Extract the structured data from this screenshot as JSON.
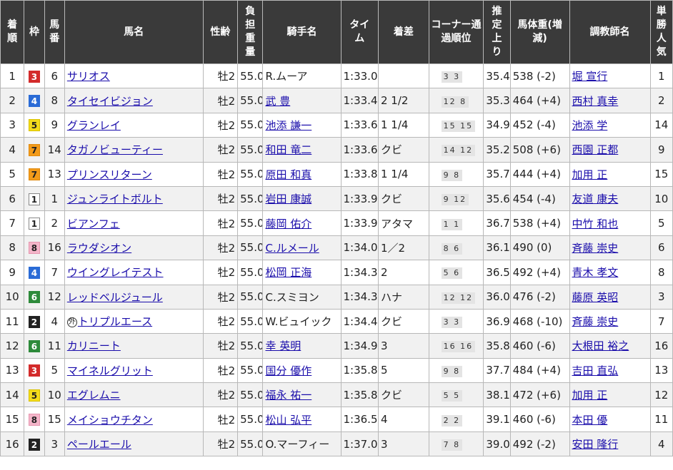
{
  "headers": {
    "rank": "着順",
    "waku": "枠",
    "umaban": "馬番",
    "horse": "馬名",
    "sexage": "性齢",
    "weight": "負担重量",
    "jockey": "騎手名",
    "time": "タイム",
    "margin": "着差",
    "corner": "コーナー通過順位",
    "last3f": "推定上り",
    "body": "馬体重(増減)",
    "trainer": "調教師名",
    "pop": "単勝人気"
  },
  "rows": [
    {
      "rank": "1",
      "waku": "3",
      "umaban": "6",
      "foreign": "",
      "horse": "サリオス",
      "sexage": "牡2",
      "weight": "55.0",
      "jockey": "R.ムーア",
      "jockey_link": false,
      "time": "1:33.0",
      "margin": "",
      "corner": "3 3",
      "last3f": "35.4",
      "body": "538 (-2)",
      "trainer": "堀 宣行",
      "pop": "1"
    },
    {
      "rank": "2",
      "waku": "4",
      "umaban": "8",
      "foreign": "",
      "horse": "タイセイビジョン",
      "sexage": "牡2",
      "weight": "55.0",
      "jockey": "武 豊",
      "jockey_link": true,
      "time": "1:33.4",
      "margin": "2 1/2",
      "corner": "12 8",
      "last3f": "35.3",
      "body": "464 (+4)",
      "trainer": "西村 真幸",
      "pop": "2"
    },
    {
      "rank": "3",
      "waku": "5",
      "umaban": "9",
      "foreign": "",
      "horse": "グランレイ",
      "sexage": "牡2",
      "weight": "55.0",
      "jockey": "池添 謙一",
      "jockey_link": true,
      "time": "1:33.6",
      "margin": "1 1/4",
      "corner": "15 15",
      "last3f": "34.9",
      "body": "452 (-4)",
      "trainer": "池添 学",
      "pop": "14"
    },
    {
      "rank": "4",
      "waku": "7",
      "umaban": "14",
      "foreign": "",
      "horse": "タガノビューティー",
      "sexage": "牡2",
      "weight": "55.0",
      "jockey": "和田 竜二",
      "jockey_link": true,
      "time": "1:33.6",
      "margin": "クビ",
      "corner": "14 12",
      "last3f": "35.2",
      "body": "508 (+6)",
      "trainer": "西園 正都",
      "pop": "9"
    },
    {
      "rank": "5",
      "waku": "7",
      "umaban": "13",
      "foreign": "",
      "horse": "プリンスリターン",
      "sexage": "牡2",
      "weight": "55.0",
      "jockey": "原田 和真",
      "jockey_link": true,
      "time": "1:33.8",
      "margin": "1 1/4",
      "corner": "9 8",
      "last3f": "35.7",
      "body": "444 (+4)",
      "trainer": "加用 正",
      "pop": "15"
    },
    {
      "rank": "6",
      "waku": "1",
      "umaban": "1",
      "foreign": "",
      "horse": "ジュンライトボルト",
      "sexage": "牡2",
      "weight": "55.0",
      "jockey": "岩田 康誠",
      "jockey_link": true,
      "time": "1:33.9",
      "margin": "クビ",
      "corner": "9 12",
      "last3f": "35.6",
      "body": "454 (-4)",
      "trainer": "友道 康夫",
      "pop": "10"
    },
    {
      "rank": "7",
      "waku": "1",
      "umaban": "2",
      "foreign": "",
      "horse": "ビアンフェ",
      "sexage": "牡2",
      "weight": "55.0",
      "jockey": "藤岡 佑介",
      "jockey_link": true,
      "time": "1:33.9",
      "margin": "アタマ",
      "corner": "1 1",
      "last3f": "36.7",
      "body": "538 (+4)",
      "trainer": "中竹 和也",
      "pop": "5"
    },
    {
      "rank": "8",
      "waku": "8",
      "umaban": "16",
      "foreign": "",
      "horse": "ラウダシオン",
      "sexage": "牡2",
      "weight": "55.0",
      "jockey": "C.ルメール",
      "jockey_link": true,
      "time": "1:34.0",
      "margin": "1／2",
      "corner": "8 6",
      "last3f": "36.1",
      "body": "490 (0)",
      "trainer": "斉藤 崇史",
      "pop": "6"
    },
    {
      "rank": "9",
      "waku": "4",
      "umaban": "7",
      "foreign": "",
      "horse": "ウイングレイテスト",
      "sexage": "牡2",
      "weight": "55.0",
      "jockey": "松岡 正海",
      "jockey_link": true,
      "time": "1:34.3",
      "margin": "2",
      "corner": "5 6",
      "last3f": "36.5",
      "body": "492 (+4)",
      "trainer": "青木 孝文",
      "pop": "8"
    },
    {
      "rank": "10",
      "waku": "6",
      "umaban": "12",
      "foreign": "",
      "horse": "レッドベルジュール",
      "sexage": "牡2",
      "weight": "55.0",
      "jockey": "C.スミヨン",
      "jockey_link": false,
      "time": "1:34.3",
      "margin": "ハナ",
      "corner": "12 12",
      "last3f": "36.0",
      "body": "476 (-2)",
      "trainer": "藤原 英昭",
      "pop": "3"
    },
    {
      "rank": "11",
      "waku": "2",
      "umaban": "4",
      "foreign": "外",
      "horse": "トリプルエース",
      "sexage": "牡2",
      "weight": "55.0",
      "jockey": "W.ビュイック",
      "jockey_link": false,
      "time": "1:34.4",
      "margin": "クビ",
      "corner": "3 3",
      "last3f": "36.9",
      "body": "468 (-10)",
      "trainer": "斉藤 崇史",
      "pop": "7"
    },
    {
      "rank": "12",
      "waku": "6",
      "umaban": "11",
      "foreign": "",
      "horse": "カリニート",
      "sexage": "牡2",
      "weight": "55.0",
      "jockey": "幸 英明",
      "jockey_link": true,
      "time": "1:34.9",
      "margin": "3",
      "corner": "16 16",
      "last3f": "35.8",
      "body": "460 (-6)",
      "trainer": "大根田 裕之",
      "pop": "16"
    },
    {
      "rank": "13",
      "waku": "3",
      "umaban": "5",
      "foreign": "",
      "horse": "マイネルグリット",
      "sexage": "牡2",
      "weight": "55.0",
      "jockey": "国分 優作",
      "jockey_link": true,
      "time": "1:35.8",
      "margin": "5",
      "corner": "9 8",
      "last3f": "37.7",
      "body": "484 (+4)",
      "trainer": "吉田 直弘",
      "pop": "13"
    },
    {
      "rank": "14",
      "waku": "5",
      "umaban": "10",
      "foreign": "",
      "horse": "エグレムニ",
      "sexage": "牡2",
      "weight": "55.0",
      "jockey": "福永 祐一",
      "jockey_link": true,
      "time": "1:35.8",
      "margin": "クビ",
      "corner": "5 5",
      "last3f": "38.1",
      "body": "472 (+6)",
      "trainer": "加用 正",
      "pop": "12"
    },
    {
      "rank": "15",
      "waku": "8",
      "umaban": "15",
      "foreign": "",
      "horse": "メイショウチタン",
      "sexage": "牡2",
      "weight": "55.0",
      "jockey": "松山 弘平",
      "jockey_link": true,
      "time": "1:36.5",
      "margin": "4",
      "corner": "2 2",
      "last3f": "39.1",
      "body": "460 (-6)",
      "trainer": "本田 優",
      "pop": "11"
    },
    {
      "rank": "16",
      "waku": "2",
      "umaban": "3",
      "foreign": "",
      "horse": "ペールエール",
      "sexage": "牡2",
      "weight": "55.0",
      "jockey": "O.マーフィー",
      "jockey_link": false,
      "time": "1:37.0",
      "margin": "3",
      "corner": "7 8",
      "last3f": "39.0",
      "body": "492 (-2)",
      "trainer": "安田 隆行",
      "pop": "4"
    }
  ]
}
